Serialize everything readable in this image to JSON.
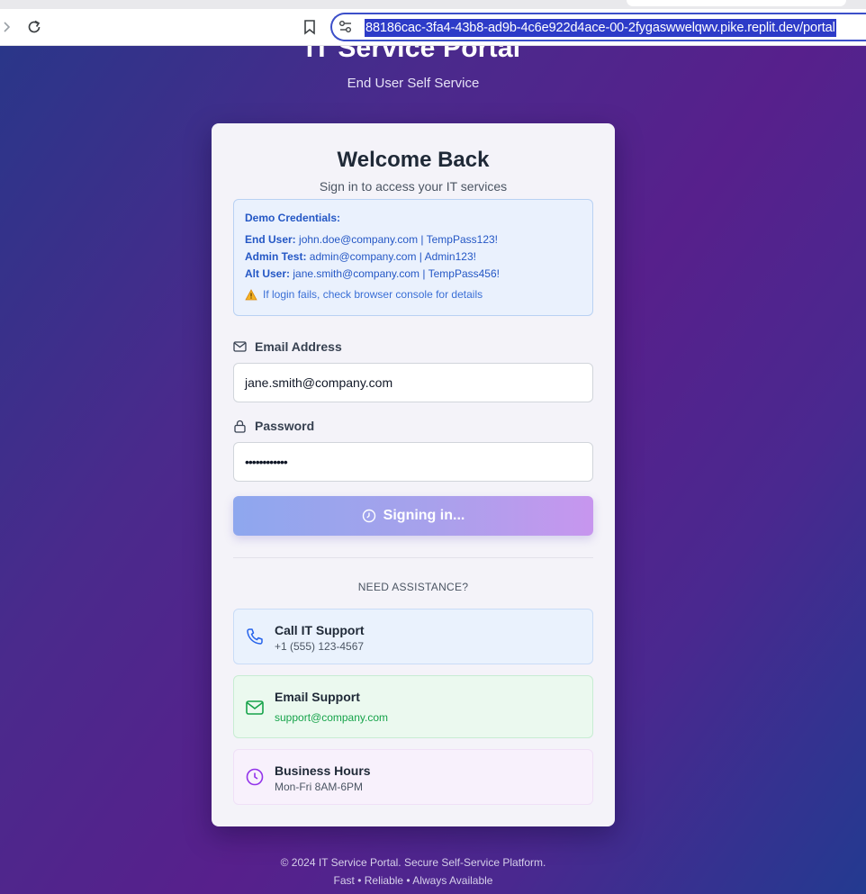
{
  "browser": {
    "url": "88186cac-3fa4-43b8-ad9b-4c6e922d4ace-00-2fygaswwelqwv.pike.replit.dev/portal"
  },
  "header": {
    "title": "IT Service Portal",
    "subtitle": "End User Self Service"
  },
  "login": {
    "title": "Welcome Back",
    "subtitle": "Sign in to access your IT services",
    "demo": {
      "heading": "Demo Credentials:",
      "lines": [
        {
          "label": "End User:",
          "value": "john.doe@company.com | TempPass123!"
        },
        {
          "label": "Admin Test:",
          "value": "admin@company.com | Admin123!"
        },
        {
          "label": "Alt User:",
          "value": "jane.smith@company.com | TempPass456!"
        }
      ],
      "warning": "If login fails, check browser console for details"
    },
    "email_label": "Email Address",
    "email_value": "jane.smith@company.com",
    "password_label": "Password",
    "password_value": "••••••••••••",
    "submit_label": "Signing in..."
  },
  "support": {
    "heading": "NEED ASSISTANCE?",
    "items": [
      {
        "title": "Call IT Support",
        "value": "+1 (555) 123-4567",
        "icon": "phone-icon",
        "accent": "#2563eb"
      },
      {
        "title": "Email Support",
        "value": "support@company.com",
        "icon": "mail-icon",
        "accent": "#16a34a"
      },
      {
        "title": "Business Hours",
        "value": "Mon-Fri 8AM-6PM",
        "icon": "clock-icon",
        "accent": "#9333ea"
      }
    ]
  },
  "footer": {
    "line1": "© 2024 IT Service Portal. Secure Self-Service Platform.",
    "line2": "Fast • Reliable • Always Available"
  }
}
